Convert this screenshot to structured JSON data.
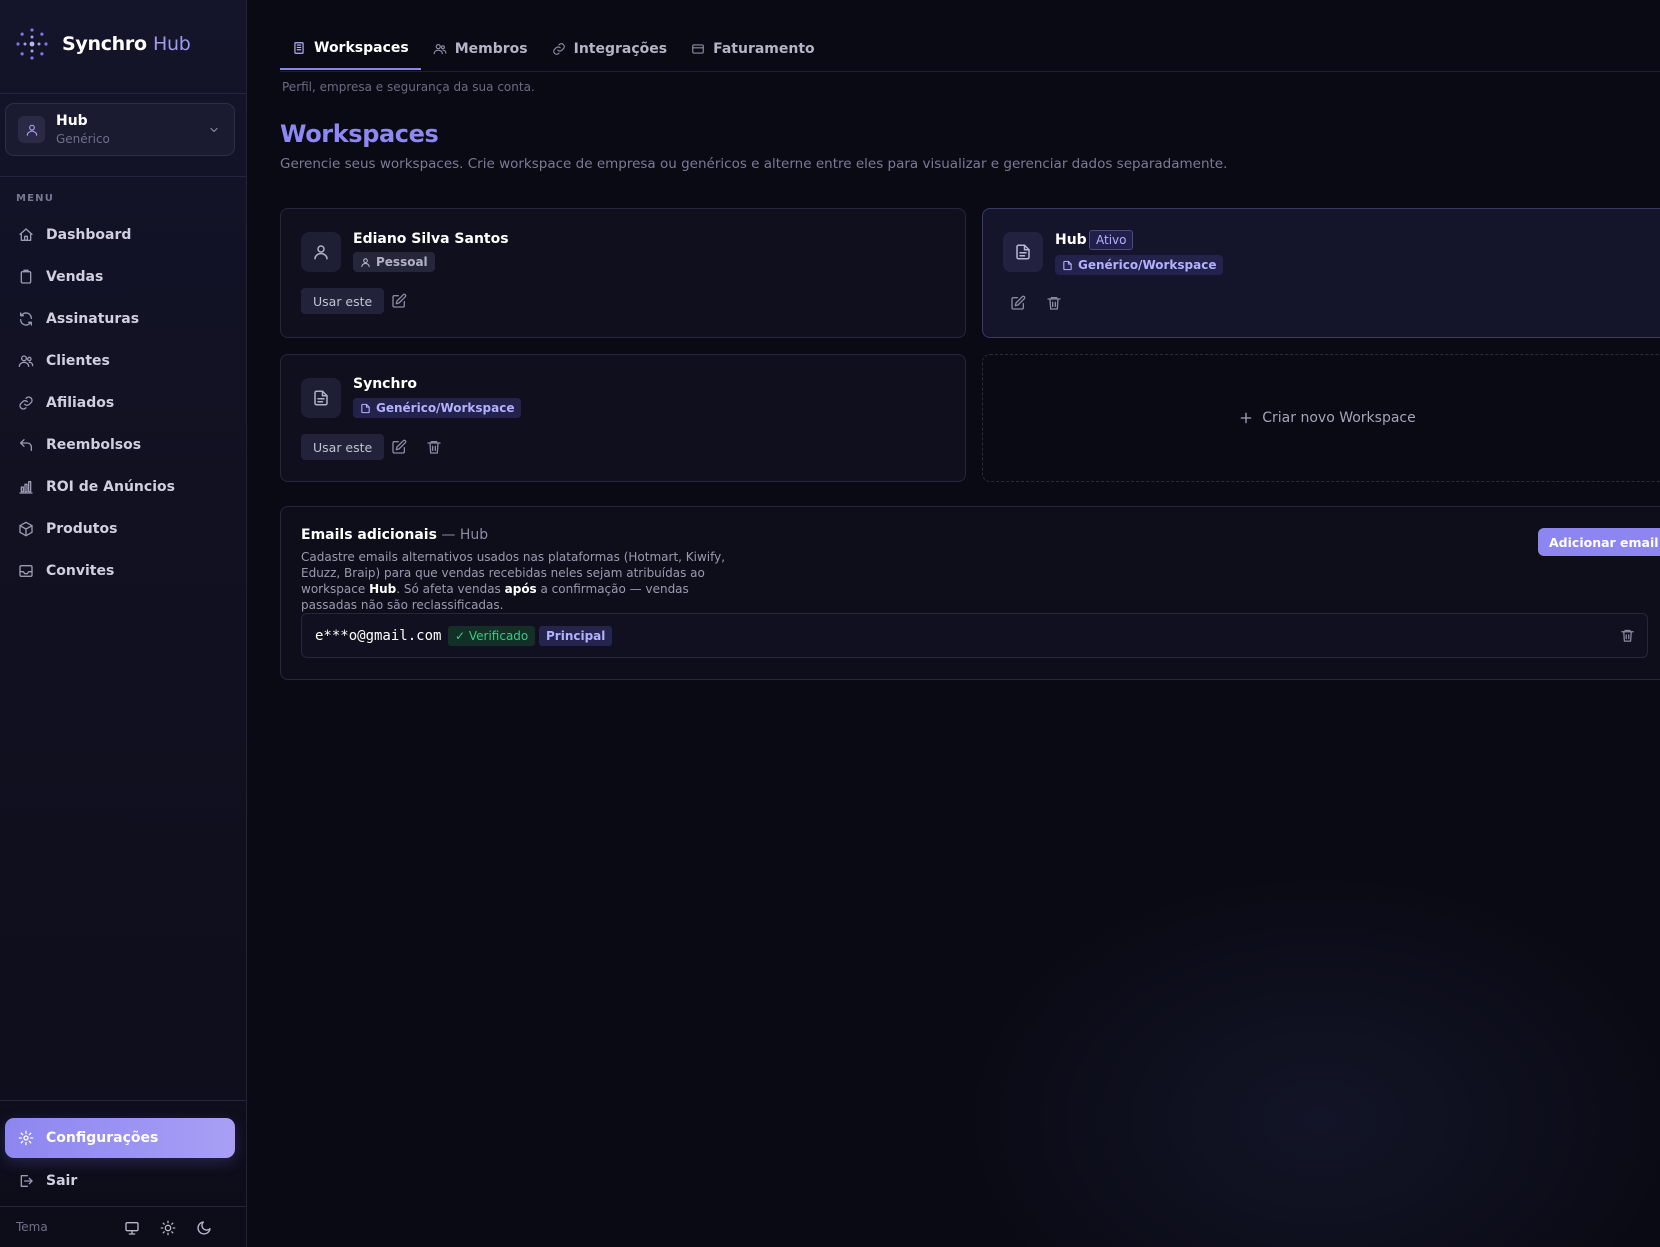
{
  "brand": {
    "name": "Synchro",
    "accent": "Hub"
  },
  "workspace_switcher": {
    "name": "Hub",
    "type": "Genérico"
  },
  "menu": {
    "label": "MENU",
    "items": [
      {
        "label": "Dashboard",
        "icon": "home-icon"
      },
      {
        "label": "Vendas",
        "icon": "clipboard-icon"
      },
      {
        "label": "Assinaturas",
        "icon": "refresh-icon"
      },
      {
        "label": "Clientes",
        "icon": "users-icon"
      },
      {
        "label": "Afiliados",
        "icon": "link-icon"
      },
      {
        "label": "Reembolsos",
        "icon": "undo-icon"
      },
      {
        "label": "ROI de Anúncios",
        "icon": "bar-chart-icon"
      },
      {
        "label": "Produtos",
        "icon": "package-icon"
      },
      {
        "label": "Convites",
        "icon": "inbox-icon"
      }
    ],
    "settings": "Configurações",
    "logout": "Sair"
  },
  "theme": {
    "label": "Tema"
  },
  "tabs": [
    {
      "label": "Workspaces",
      "icon": "building-icon",
      "active": true
    },
    {
      "label": "Membros",
      "icon": "users-icon"
    },
    {
      "label": "Integrações",
      "icon": "link-icon"
    },
    {
      "label": "Faturamento",
      "icon": "credit-card-icon"
    }
  ],
  "page": {
    "subtitle": "Perfil, empresa e segurança da sua conta.",
    "title": "Workspaces",
    "description": "Gerencie seus workspaces. Crie workspace de empresa ou genéricos e alterne entre eles para visualizar e gerenciar dados separadamente."
  },
  "workspaces": [
    {
      "name": "Ediano Silva Santos",
      "type": "Pessoal",
      "use_label": "Usar este"
    },
    {
      "name": "Hub",
      "status": "Ativo",
      "type": "Genérico/Workspace"
    },
    {
      "name": "Synchro",
      "type": "Genérico/Workspace",
      "use_label": "Usar este"
    }
  ],
  "create_workspace": "Criar novo Workspace",
  "emails": {
    "title": "Emails adicionais",
    "suffix": " — Hub",
    "desc_1": "Cadastre emails alternativos usados nas plataformas (Hotmart, Kiwify, Eduzz, Braip) para que vendas recebidas neles sejam atribuídas ao workspace ",
    "desc_ws": "Hub",
    "desc_2": ". Só afeta vendas ",
    "desc_bold": "após",
    "desc_3": " a confirmação — vendas passadas não são reclassificadas.",
    "add_label": "Adicionar email",
    "list": [
      {
        "address": "e***o@gmail.com",
        "verified": "✓ Verificado",
        "primary": "Principal"
      }
    ]
  },
  "colors": {
    "accent": "#8d86f0",
    "success": "#3cc884",
    "background": "#0a0a14"
  }
}
